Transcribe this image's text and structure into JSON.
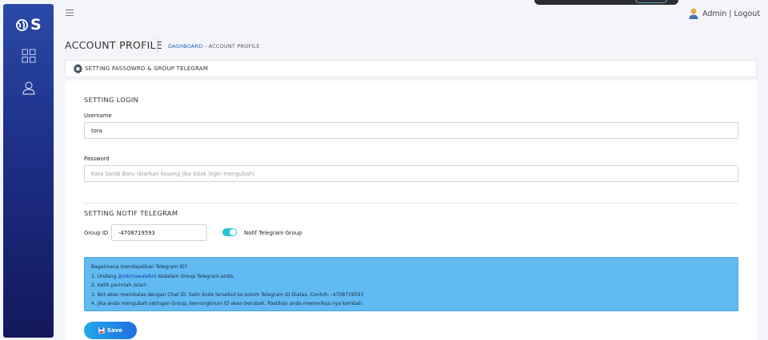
{
  "brand": {
    "logo_letter": "S"
  },
  "sidebar": {
    "items": [
      {
        "icon": "grid-icon"
      },
      {
        "icon": "user-icon"
      }
    ]
  },
  "header": {
    "user_label": "Admin | Logout"
  },
  "page": {
    "title": "ACCOUNT PROFILE",
    "breadcrumb": {
      "home": "DASHBOARD",
      "separator": "-",
      "current": "ACCOUNT PROFILE"
    }
  },
  "card": {
    "header_title": "SETTING PASSOWRD & GROUP TELEGRAM",
    "login": {
      "section_title": "SETTING LOGIN",
      "username_label": "Username",
      "username_value": "tora",
      "password_label": "Password",
      "password_placeholder": "Kata Sandi Baru (biarkan kosong jika tidak ingin mengubah)"
    },
    "telegram": {
      "section_title": "SETTING NOTIF TELEGRAM",
      "group_id_label": "Group ID",
      "group_id_value": "-4708719593",
      "toggle_label": "Notif Telegram Group",
      "toggle_on": true
    },
    "info": {
      "heading": "Bagaimana mendapatkan Telegram ID?",
      "step1_prefix": "1. Undang ",
      "step1_mention": "@sikmawalabot",
      "step1_suffix": " kedalam Group Telegram anda.",
      "step2": "2. Ketik perintah /start",
      "step3": "3. Bot akan membalas dengan Chat ID. Salin kode tersebut ke kolom Telegram ID Diatas. Contoh: -4708719593",
      "step4": "4. Jika anda mengubah setingan Group, kemungkinan ID akan berubah. Pastikan anda memeriksa nya kembali."
    },
    "save_label": "Save"
  },
  "colors": {
    "sidebar_top": "#2a49a6",
    "sidebar_bottom": "#12185a",
    "info_bg": "#62baf3",
    "toggle": "#22c5d6",
    "link": "#1f5fb8"
  }
}
